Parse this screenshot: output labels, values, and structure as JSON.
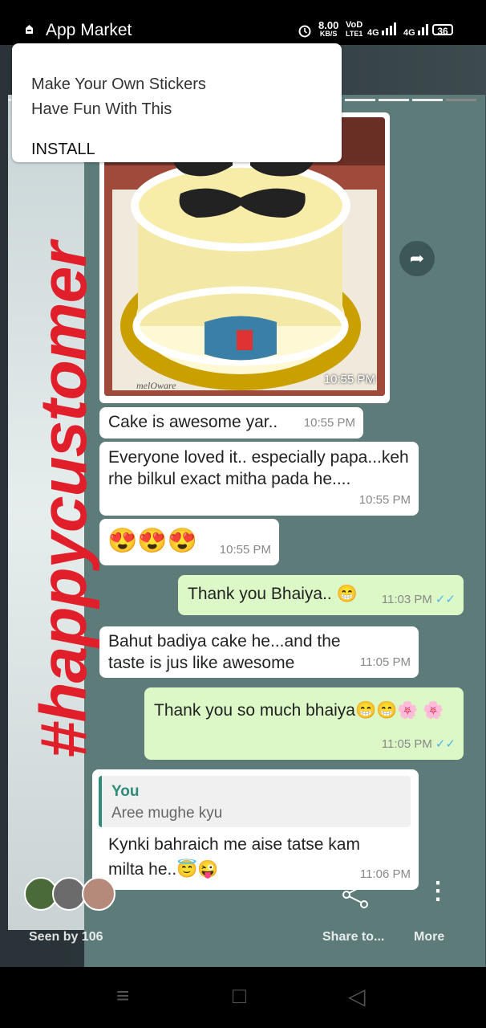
{
  "status_bar": {
    "app_title": "App Market",
    "speed_value": "8.00",
    "speed_unit": "KB/S",
    "volte_top": "VoD",
    "volte_bottom": "LTE1",
    "network1": "4G",
    "network2": "4G",
    "battery": "36"
  },
  "ad": {
    "line1": "Make Your Own Stickers",
    "line2": "Have Fun With This",
    "install_label": "INSTALL"
  },
  "overlay": {
    "hashtag": "#happycustomer"
  },
  "chat": {
    "image": {
      "time": "10:55 PM",
      "plate_text": "melOware"
    },
    "messages": [
      {
        "text": "Cake is awesome yar..",
        "time": "10:55 PM"
      },
      {
        "text": "Everyone loved it.. especially papa...keh rhe bilkul exact mitha pada he....",
        "time": "10:55 PM"
      },
      {
        "text": "😍😍😍",
        "time": "10:55 PM"
      },
      {
        "text": "Thank you Bhaiya.. 😁",
        "time": "11:03 PM"
      },
      {
        "text": "Bahut badiya cake he...and the taste is jus like awesome",
        "time": "11:05 PM"
      },
      {
        "text": "Thank you so much bhaiya😁😁🌸 🌸",
        "time": "11:05 PM"
      },
      {
        "text": "Kynki bahraich me aise tatse kam milta he..😇😜",
        "time": "11:06 PM",
        "reply": {
          "author": "You",
          "text": "Aree mughe kyu"
        }
      }
    ],
    "ticks": "✓✓"
  },
  "story_footer": {
    "seen_by": "Seen by 106",
    "share_label": "Share to...",
    "more_label": "More"
  },
  "icons": {
    "forward": "➦",
    "share": "share-icon",
    "more": "⋮",
    "nav_menu": "≡",
    "nav_home": "□",
    "nav_back": "◁"
  },
  "colors": {
    "hashtag": "#e01f2a",
    "chat_bg": "#5c7b79",
    "outgoing_bubble": "#dcf8c6",
    "read_ticks": "#4fb6ec"
  }
}
